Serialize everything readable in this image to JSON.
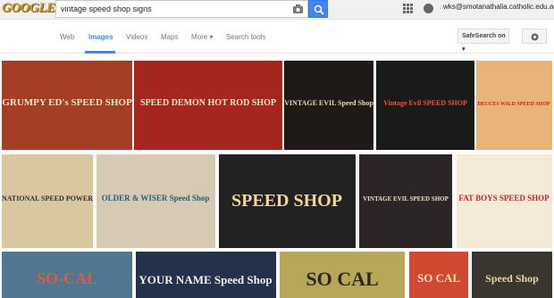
{
  "logo": {
    "text": "GOOGLE"
  },
  "search": {
    "query": "vintage speed shop signs"
  },
  "header": {
    "account": "wks@smotanathalia.catholic.edu.au"
  },
  "tabs": [
    {
      "label": "Web",
      "active": false
    },
    {
      "label": "Images",
      "active": true
    },
    {
      "label": "Videos",
      "active": false
    },
    {
      "label": "Maps",
      "active": false
    },
    {
      "label": "More ▾",
      "active": false
    },
    {
      "label": "Search tools",
      "active": false
    }
  ],
  "safesearch": {
    "label": "SafeSearch on ▾"
  },
  "results": [
    {
      "text": "GRUMPY ED's SPEED SHOP",
      "bg": "#a63d26",
      "fg": "#f3e3c4"
    },
    {
      "text": "SPEED DEMON HOT ROD SHOP",
      "bg": "#a5261e",
      "fg": "#f2e3c5"
    },
    {
      "text": "VINTAGE EVIL Speed Shop",
      "bg": "#1f1a17",
      "fg": "#e6d8b8"
    },
    {
      "text": "Vintage Evil SPEED SHOP",
      "bg": "#1a1a1a",
      "fg": "#e35a3a"
    },
    {
      "text": "DEUCES WILD SPEED SHOP",
      "bg": "#e8b477",
      "fg": "#b52b23"
    },
    {
      "text": "NATIONAL SPEED POWER",
      "bg": "#d9c7a0",
      "fg": "#2e2f3a"
    },
    {
      "text": "OLDER & WISER Speed Shop",
      "bg": "#d6cab4",
      "fg": "#2b5d78"
    },
    {
      "text": "SPEED SHOP",
      "bg": "#222222",
      "fg": "#f2d79a"
    },
    {
      "text": "VINTAGE EVIL SPEED SHOP",
      "bg": "#2b2526",
      "fg": "#eae0c8"
    },
    {
      "text": "FAT BOYS SPEED SHOP",
      "bg": "#f5e9d8",
      "fg": "#c0282d"
    },
    {
      "text": "SO-CAL",
      "bg": "#4f7792",
      "fg": "#e35a3a"
    },
    {
      "text": "YOUR NAME Speed Shop",
      "bg": "#24314a",
      "fg": "#f2f2f2"
    },
    {
      "text": "SO CAL",
      "bg": "#b8a659",
      "fg": "#2a2a1d"
    },
    {
      "text": "SO CAL",
      "bg": "#d14830",
      "fg": "#f2e0b8"
    },
    {
      "text": "Speed Shop",
      "bg": "#3a362f",
      "fg": "#e6d4a4"
    }
  ]
}
